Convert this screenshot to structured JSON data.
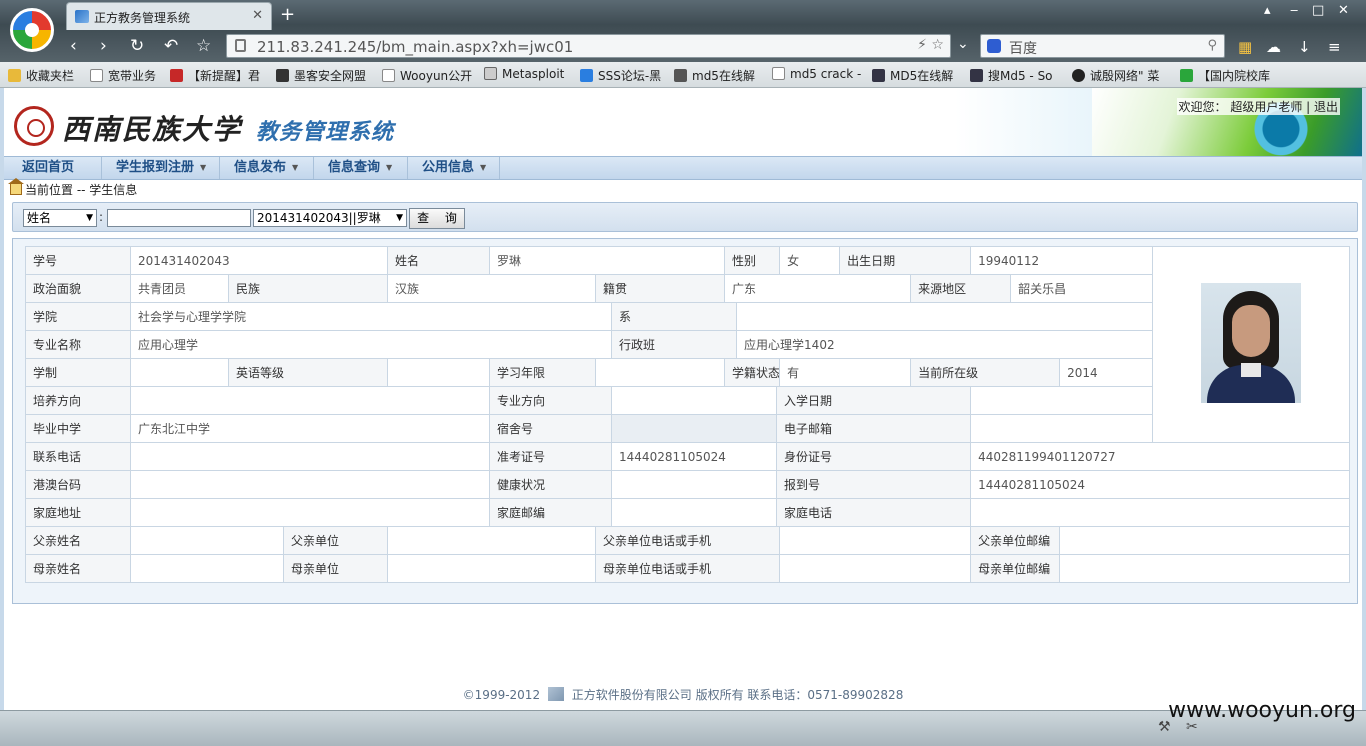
{
  "browser": {
    "tab_title": "正方教务管理系统",
    "tab_close": "✕",
    "new_tab": "+",
    "address": "211.83.241.245/bm_main.aspx?xh=jwc01",
    "search_placeholder": "百度",
    "bookmarks": [
      "收藏夹栏",
      "宽带业务",
      "【新提醒】君",
      "墨客安全网盟",
      "Wooyun公开",
      "Metasploit",
      "SSS论坛-黑",
      "md5在线解",
      "md5 crack -",
      "MD5在线解",
      "搜Md5 - So",
      "诚殷网络\" 菜",
      "【国内院校库"
    ]
  },
  "header": {
    "school_name": "西南民族大学",
    "system_name": "教务管理系统",
    "welcome": "欢迎您： 超级用户老师 | 退出"
  },
  "menu": [
    {
      "label": "返回首页",
      "arrow": ""
    },
    {
      "label": "学生报到注册",
      "arrow": "▼"
    },
    {
      "label": "信息发布",
      "arrow": "▼"
    },
    {
      "label": "信息查询",
      "arrow": "▼"
    },
    {
      "label": "公用信息",
      "arrow": "▼"
    }
  ],
  "breadcrumb": "当前位置 -- 学生信息",
  "query": {
    "field_select": "姓名",
    "colon": ":",
    "input_value": "",
    "student_select": "201431402043||罗琳",
    "button": "查 询",
    "arrow": "▼"
  },
  "student": {
    "labels": {
      "xh": "学号",
      "xm": "姓名",
      "xb": "性别",
      "csrq": "出生日期",
      "zzmm": "政治面貌",
      "mz": "民族",
      "jg": "籍贯",
      "lydq": "来源地区",
      "xy": "学院",
      "xi": "系",
      "zymc": "专业名称",
      "xzb": "行政班",
      "xz": "学制",
      "yydj": "英语等级",
      "xxnx": "学习年限",
      "xjzt": "学籍状态",
      "dqszj": "当前所在级",
      "pyfx": "培养方向",
      "zyfx": "专业方向",
      "rxrq": "入学日期",
      "byzx": "毕业中学",
      "ssh": "宿舍号",
      "dzyx": "电子邮箱",
      "lxdh": "联系电话",
      "zkzh": "准考证号",
      "sfzh": "身份证号",
      "gatm": "港澳台码",
      "jkzk": "健康状况",
      "bdh": "报到号",
      "jtdz": "家庭地址",
      "jtyb": "家庭邮编",
      "jtdh": "家庭电话",
      "fqxm": "父亲姓名",
      "fqdw": "父亲单位",
      "fqdh": "父亲单位电话或手机",
      "fqyb": "父亲单位邮编",
      "mqxm": "母亲姓名",
      "mqdw": "母亲单位",
      "mqdh": "母亲单位电话或手机",
      "mqyb": "母亲单位邮编"
    },
    "values": {
      "xh": "201431402043",
      "xm": "罗琳",
      "xb": "女",
      "csrq": "19940112",
      "zzmm": "共青团员",
      "mz": "汉族",
      "jg": "广东",
      "lydq": "韶关乐昌",
      "xy": "社会学与心理学学院",
      "xi": "",
      "zymc": "应用心理学",
      "xzb": "应用心理学1402",
      "xz": "",
      "yydj": "",
      "xxnx": "",
      "xjzt": "有",
      "dqszj": "2014",
      "pyfx": "",
      "zyfx": "",
      "rxrq": "",
      "byzx": "广东北江中学",
      "ssh": "",
      "dzyx": "",
      "lxdh": "",
      "zkzh": "14440281105024",
      "sfzh": "440281199401120727",
      "gatm": "",
      "jkzk": "",
      "bdh": "14440281105024",
      "jtdz": "",
      "jtyb": "",
      "jtdh": "",
      "fqxm": "",
      "fqdw": "",
      "fqdh": "",
      "fqyb": "",
      "mqxm": "",
      "mqdw": "",
      "mqdh": "",
      "mqyb": ""
    }
  },
  "footer": {
    "copyright": "©1999-2012",
    "company": "正方软件股份有限公司 版权所有 联系电话：0571-89902828"
  },
  "watermark": "www.wooyun.org",
  "colors": {
    "menu_text": "#1f4f86",
    "system_name": "#2f6fae",
    "table_border": "#c9d6e3"
  }
}
